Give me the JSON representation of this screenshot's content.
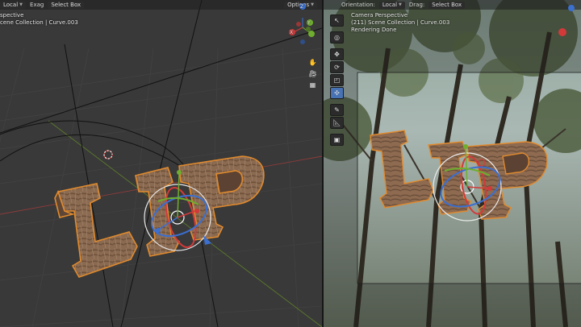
{
  "left_header": {
    "mode": "Local",
    "menu_extra": "Exag",
    "select_mode": "Select Box",
    "options": "Options"
  },
  "left_overlay": {
    "line1": "spective",
    "line2": "cene Collection | Curve.003"
  },
  "right_header": {
    "orientation_label": "Orientation:",
    "orientation_value": "Local",
    "drag_label": "Drag:",
    "select_mode": "Select Box"
  },
  "right_overlay": {
    "line1": "Camera Perspective",
    "line2": "(211) Scene Collection | Curve.003",
    "line3": "Rendering Done"
  },
  "gizmo_axes": {
    "x": "X",
    "y": "Y",
    "z": "Z"
  },
  "icons": [
    "cursor-icon",
    "move-icon",
    "rotate-icon",
    "scale-icon",
    "transform-icon",
    "annotate-icon",
    "measure-icon",
    "add-cube-icon",
    "hand-icon",
    "camera-icon",
    "grid-icon"
  ]
}
